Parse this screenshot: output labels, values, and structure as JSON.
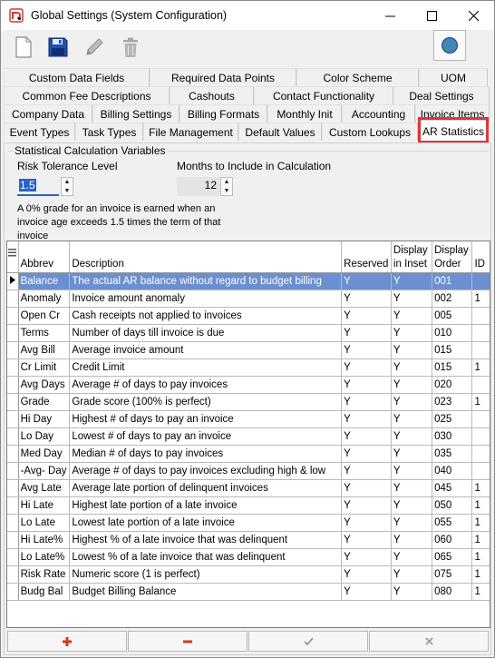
{
  "window": {
    "title": "Global Settings (System Configuration)",
    "app_icon": "app-logo-icon",
    "controls": [
      "minimize-icon",
      "maximize-icon",
      "close-icon"
    ]
  },
  "toolbar": {
    "buttons": [
      "new-document-icon",
      "save-icon",
      "edit-pencil-icon",
      "delete-trash-icon"
    ],
    "right_button": "globe-icon"
  },
  "tabs": {
    "row1": [
      "Custom Data Fields",
      "Required Data Points",
      "Color Scheme",
      "UOM"
    ],
    "row2": [
      "Common Fee Descriptions",
      "Cashouts",
      "Contact Functionality",
      "Deal Settings"
    ],
    "row3": [
      "Company Data",
      "Billing Settings",
      "Billing Formats",
      "Monthly Init",
      "Accounting",
      "Invoice Items"
    ],
    "row4": [
      "Event Types",
      "Task Types",
      "File Management",
      "Default Values",
      "Custom Lookups",
      "AR Statistics"
    ],
    "active": "AR Statistics",
    "highlight_color": "#e0343d"
  },
  "group": {
    "title": "Statistical Calculation Variables",
    "risk_label": "Risk Tolerance Level",
    "risk_value": "1.5",
    "months_label": "Months to Include in Calculation",
    "months_value": "12",
    "description": "A 0% grade for an invoice is earned when an invoice age exceeds 1.5 times the term of that invoice"
  },
  "grid": {
    "columns": [
      "Abbrev",
      "Description",
      "Reserved",
      "Display in Inset",
      "Display Order",
      "ID"
    ],
    "selected_row": 0,
    "selection_color": "#6b8fd0",
    "rows": [
      [
        "Balance",
        "The actual AR balance without regard to budget billing",
        "Y",
        "Y",
        "001",
        ""
      ],
      [
        "Anomaly",
        "Invoice amount anomaly",
        "Y",
        "Y",
        "002",
        "1"
      ],
      [
        "Open Cr",
        "Cash receipts not applied to invoices",
        "Y",
        "Y",
        "005",
        ""
      ],
      [
        "Terms",
        "Number of days till invoice is due",
        "Y",
        "Y",
        "010",
        ""
      ],
      [
        "Avg Bill",
        "Average invoice amount",
        "Y",
        "Y",
        "015",
        ""
      ],
      [
        "Cr Limit",
        "Credit Limit",
        "Y",
        "Y",
        "015",
        "1"
      ],
      [
        "Avg Days",
        "Average # of days to pay invoices",
        "Y",
        "Y",
        "020",
        ""
      ],
      [
        "Grade",
        "Grade score (100% is perfect)",
        "Y",
        "Y",
        "023",
        "1"
      ],
      [
        "Hi Day",
        "Highest # of days to pay an invoice",
        "Y",
        "Y",
        "025",
        ""
      ],
      [
        "Lo Day",
        "Lowest # of days to pay an invoice",
        "Y",
        "Y",
        "030",
        ""
      ],
      [
        "Med Day",
        "Median # of days to pay invoices",
        "Y",
        "Y",
        "035",
        ""
      ],
      [
        "-Avg- Day",
        "Average # of days to pay invoices excluding high & low",
        "Y",
        "Y",
        "040",
        ""
      ],
      [
        "Avg Late",
        "Average late portion of delinquent invoices",
        "Y",
        "Y",
        "045",
        "1"
      ],
      [
        "Hi Late",
        "Highest late portion of a late invoice",
        "Y",
        "Y",
        "050",
        "1"
      ],
      [
        "Lo Late",
        "Lowest late portion of a late invoice",
        "Y",
        "Y",
        "055",
        "1"
      ],
      [
        "Hi Late%",
        "Highest % of a late invoice that was delinquent",
        "Y",
        "Y",
        "060",
        "1"
      ],
      [
        "Lo Late%",
        "Lowest % of a late invoice that was delinquent",
        "Y",
        "Y",
        "065",
        "1"
      ],
      [
        "Risk Rate",
        "Numeric score (1 is perfect)",
        "Y",
        "Y",
        "075",
        "1"
      ],
      [
        "Budg Bal",
        "Budget Billing Balance",
        "Y",
        "Y",
        "080",
        "1"
      ]
    ]
  },
  "footer": {
    "buttons": [
      "add-plus-icon",
      "remove-minus-icon",
      "confirm-check-icon",
      "cancel-x-icon"
    ]
  }
}
